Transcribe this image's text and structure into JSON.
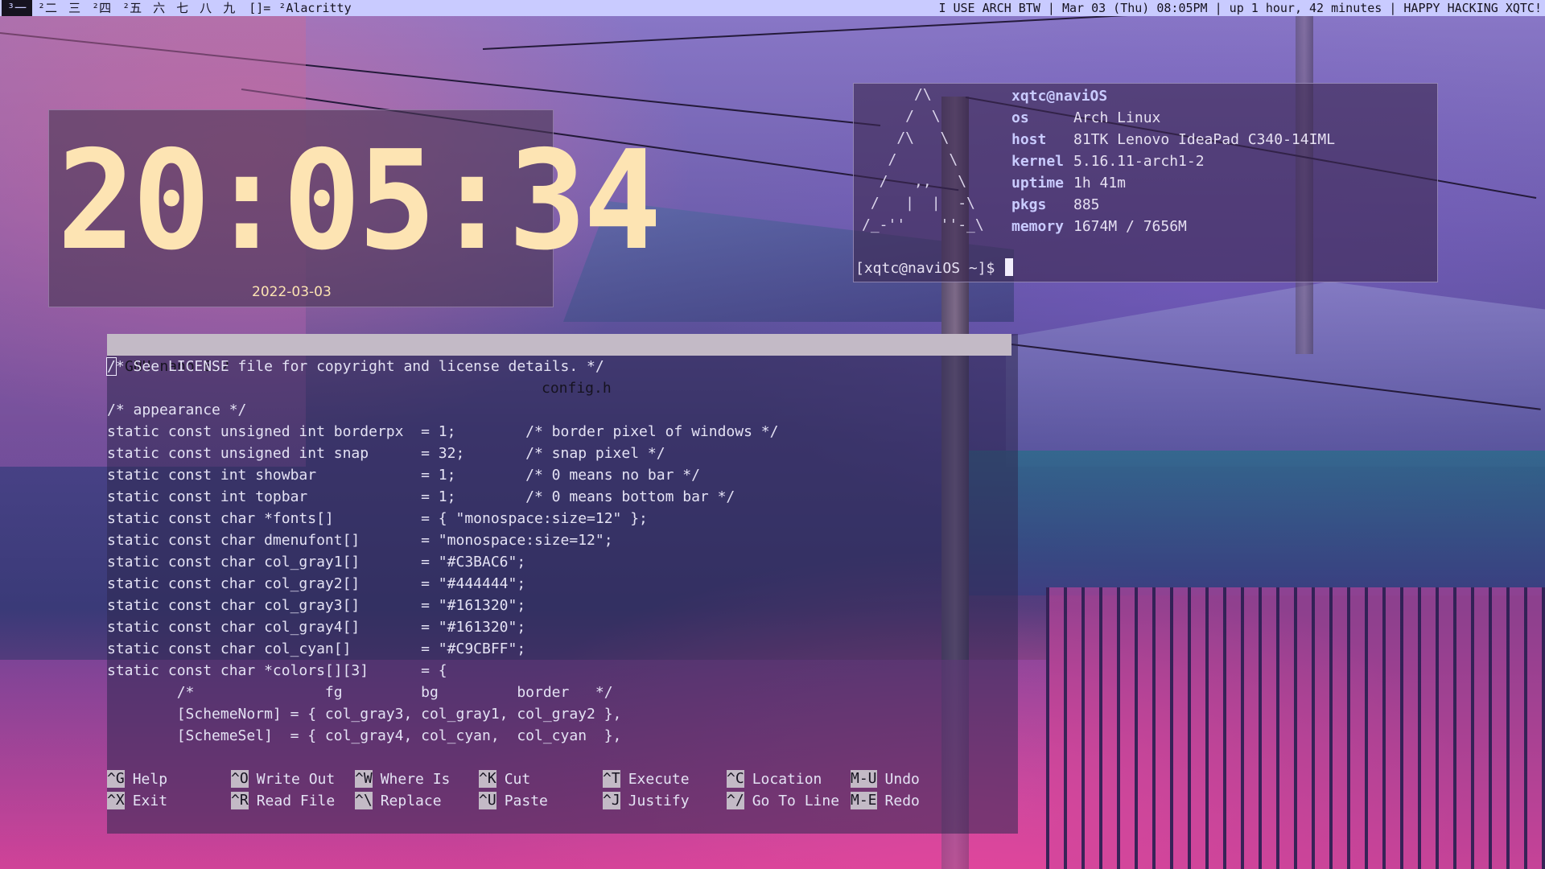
{
  "topbar": {
    "tags": [
      {
        "label": "³一",
        "selected": true
      },
      {
        "label": "²二",
        "selected": false
      },
      {
        "label": "三",
        "selected": false
      },
      {
        "label": "²四",
        "selected": false
      },
      {
        "label": "²五",
        "selected": false
      },
      {
        "label": "六",
        "selected": false
      },
      {
        "label": "七",
        "selected": false
      },
      {
        "label": "八",
        "selected": false
      },
      {
        "label": "九",
        "selected": false
      }
    ],
    "layout_symbol": "[]=",
    "window_title": "²Alacritty",
    "status": "I USE ARCH BTW | Mar 03 (Thu) 08:05PM | up 1 hour, 42 minutes | HAPPY HACKING XQTC!"
  },
  "clock": {
    "time": "20:05:34",
    "date": "2022-03-03"
  },
  "fetch": {
    "ascii_art": "      /\\\n     /  \\\n    /\\   \\\n   /      \\\n  /   ,,   \\\n /   |  |  -\\\n/_-''    ''-_\\",
    "user": "xqtc@naviOS",
    "rows": [
      {
        "key": "os",
        "value": "Arch Linux"
      },
      {
        "key": "host",
        "value": "81TK Lenovo IdeaPad C340-14IML"
      },
      {
        "key": "kernel",
        "value": "5.16.11-arch1-2"
      },
      {
        "key": "uptime",
        "value": "1h 41m"
      },
      {
        "key": "pkgs",
        "value": "885"
      },
      {
        "key": "memory",
        "value": "1674M / 7656M"
      }
    ],
    "prompt": "[xqtc@naviOS ~]$ "
  },
  "nano": {
    "version": "GNU nano 6.2",
    "filename": "config.h",
    "first_char": "/",
    "first_rest": "* See LICENSE file for copyright and license details. */",
    "lines": [
      "",
      "/* appearance */",
      "static const unsigned int borderpx  = 1;        /* border pixel of windows */",
      "static const unsigned int snap      = 32;       /* snap pixel */",
      "static const int showbar            = 1;        /* 0 means no bar */",
      "static const int topbar             = 1;        /* 0 means bottom bar */",
      "static const char *fonts[]          = { \"monospace:size=12\" };",
      "static const char dmenufont[]       = \"monospace:size=12\";",
      "static const char col_gray1[]       = \"#C3BAC6\";",
      "static const char col_gray2[]       = \"#444444\";",
      "static const char col_gray3[]       = \"#161320\";",
      "static const char col_gray4[]       = \"#161320\";",
      "static const char col_cyan[]        = \"#C9CBFF\";",
      "static const char *colors[][3]      = {",
      "        /*               fg         bg         border   */",
      "        [SchemeNorm] = { col_gray3, col_gray1, col_gray2 },",
      "        [SchemeSel]  = { col_gray4, col_cyan,  col_cyan  },"
    ],
    "help_row1": [
      {
        "key": "^G",
        "label": "Help"
      },
      {
        "key": "^O",
        "label": "Write Out"
      },
      {
        "key": "^W",
        "label": "Where Is"
      },
      {
        "key": "^K",
        "label": "Cut"
      },
      {
        "key": "^T",
        "label": "Execute"
      },
      {
        "key": "^C",
        "label": "Location"
      },
      {
        "key": "M-U",
        "label": "Undo"
      }
    ],
    "help_row2": [
      {
        "key": "^X",
        "label": "Exit"
      },
      {
        "key": "^R",
        "label": "Read File"
      },
      {
        "key": "^\\",
        "label": "Replace"
      },
      {
        "key": "^U",
        "label": "Paste"
      },
      {
        "key": "^J",
        "label": "Justify"
      },
      {
        "key": "^/",
        "label": "Go To Line"
      },
      {
        "key": "M-E",
        "label": "Redo"
      }
    ]
  },
  "colors": {
    "bar_bg": "#C9CBFF",
    "bar_fg": "#161320",
    "nano_head_bg": "#C3BAC6",
    "clock_fg": "#FDE4B3"
  }
}
